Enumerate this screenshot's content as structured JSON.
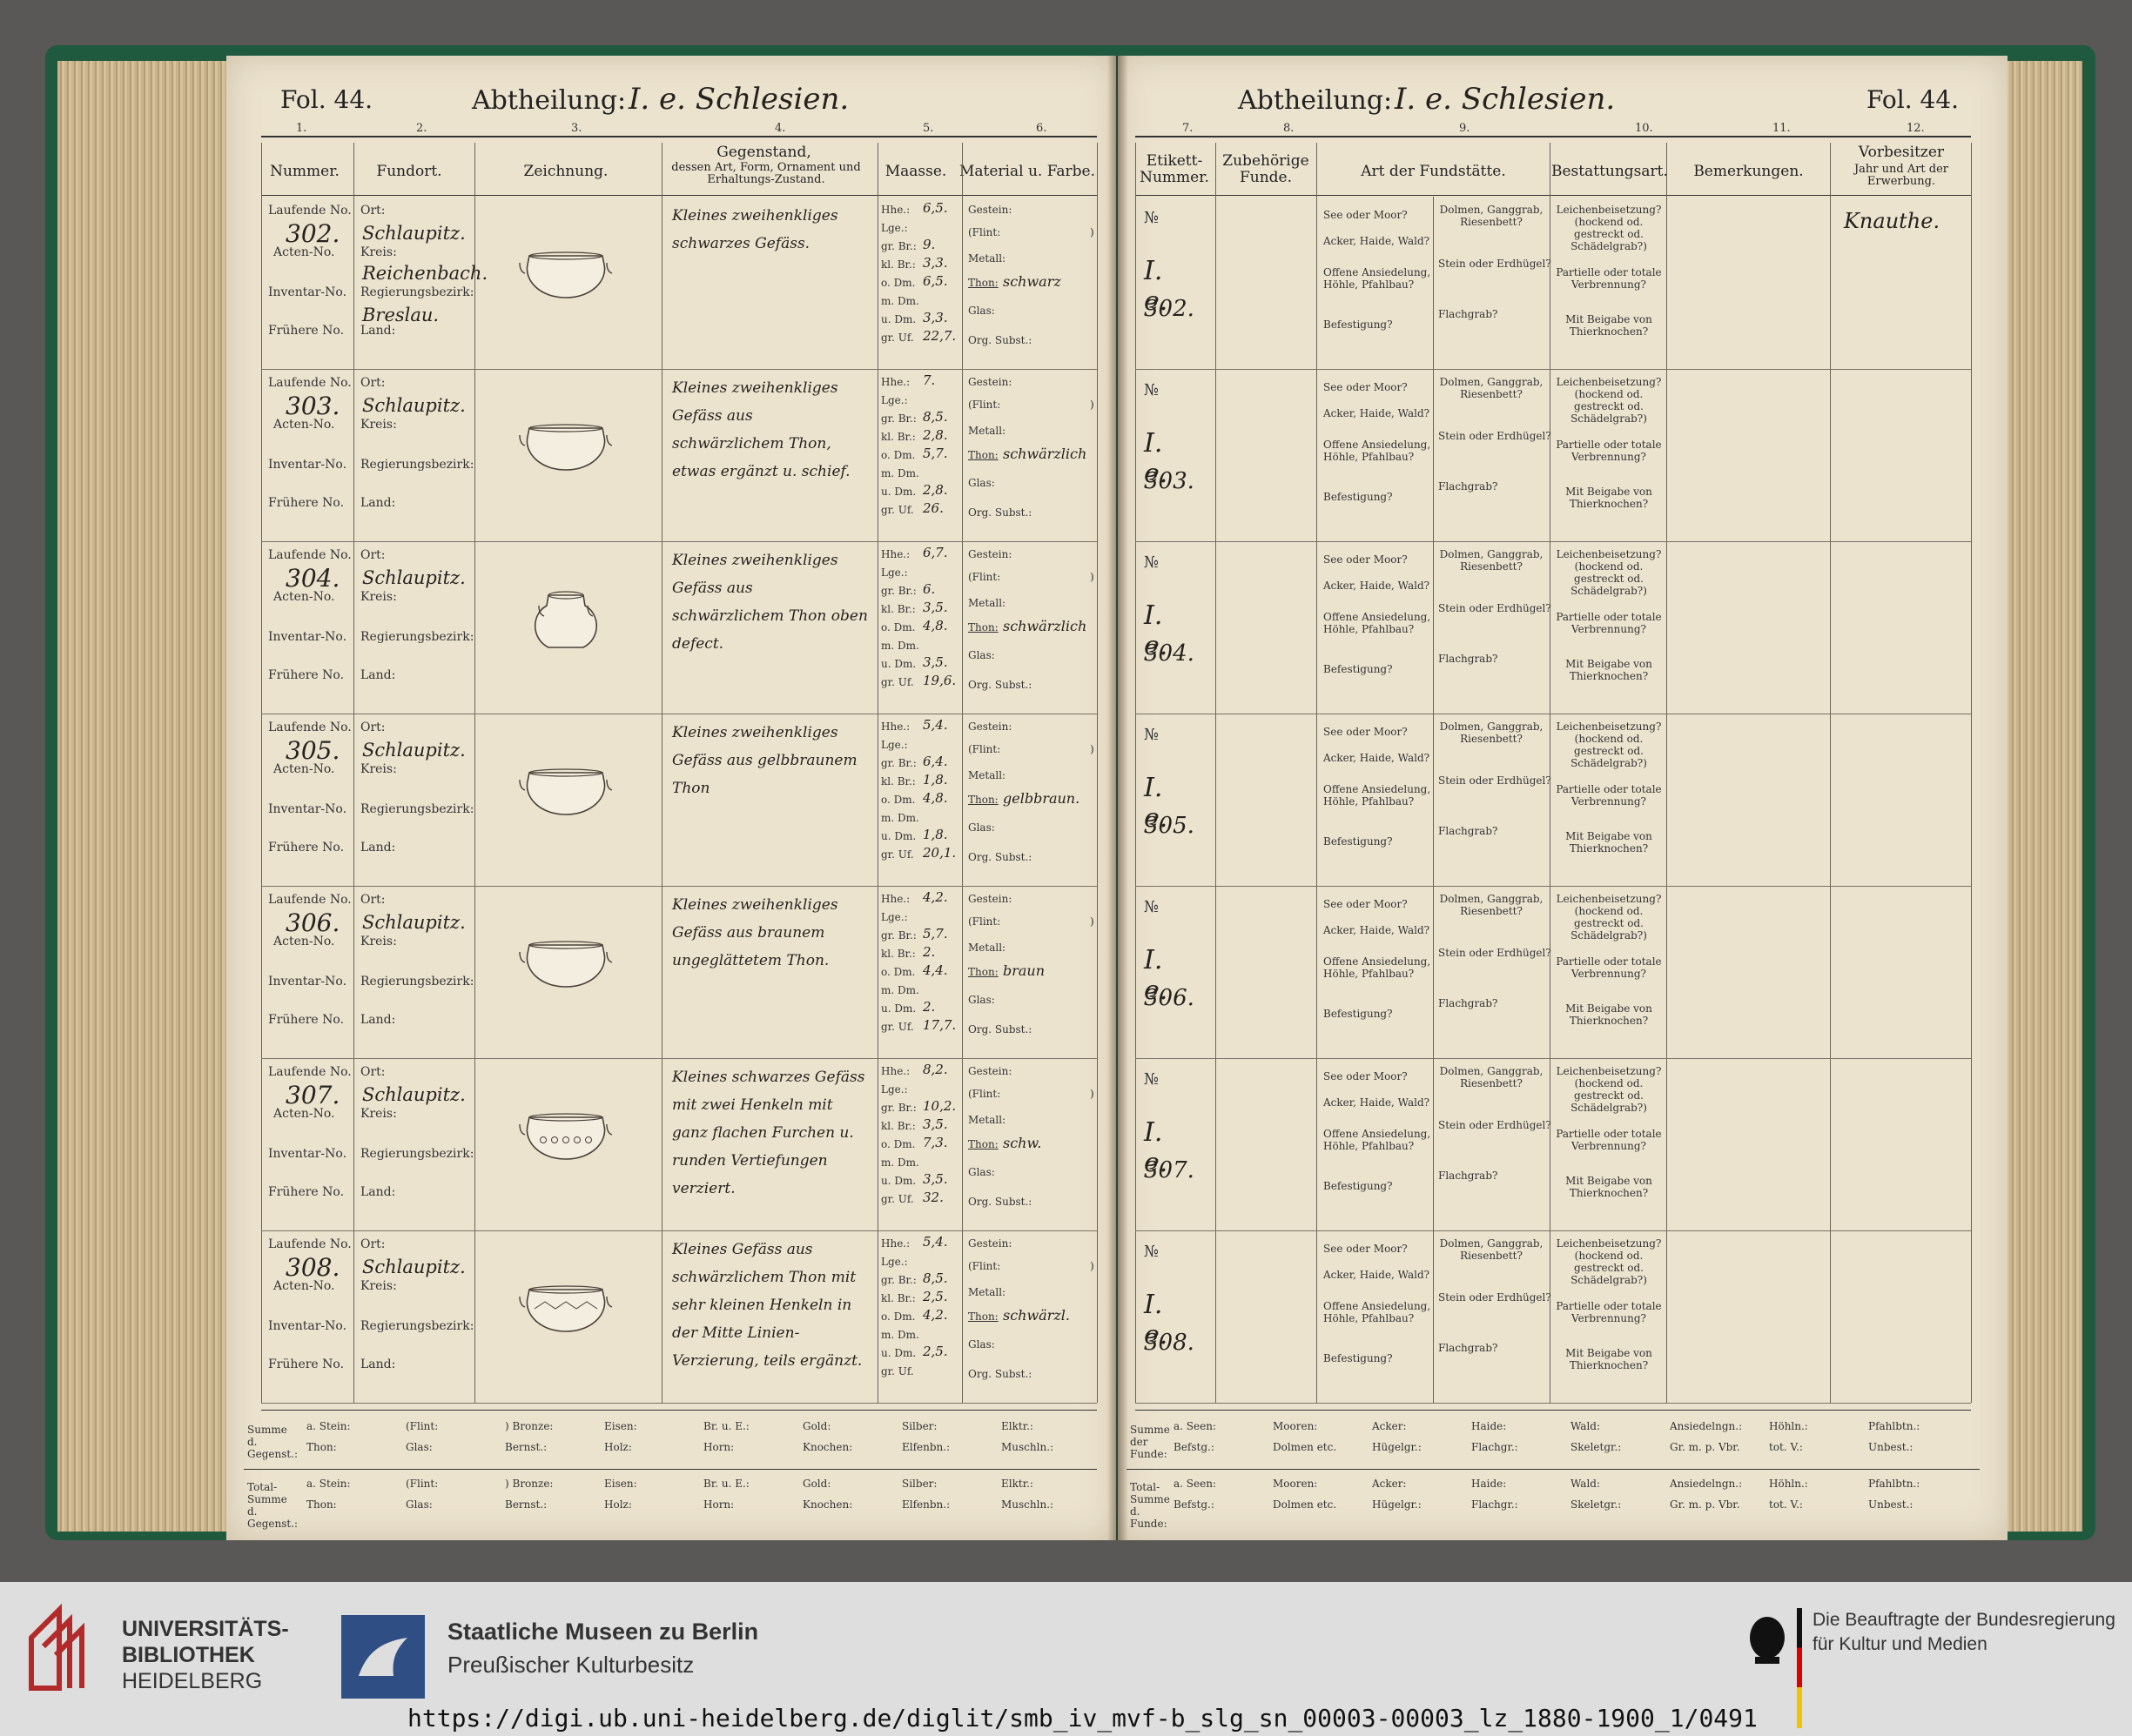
{
  "left_page": {
    "fol": "Fol. 44.",
    "abtheilung_label": "Abtheilung:",
    "abtheilung_value": "I. e. Schlesien.",
    "col_numbers": [
      "1.",
      "2.",
      "3.",
      "4.",
      "5.",
      "6."
    ],
    "headers": {
      "nummer": "Nummer.",
      "fundort": "Fundort.",
      "zeichnung": "Zeichnung.",
      "gegenstand": "Gegenstand,",
      "gegenstand_sub": "dessen Art, Form, Ornament und Erhaltungs-Zustand.",
      "maasse": "Maasse.",
      "material": "Material u. Farbe."
    }
  },
  "right_page": {
    "fol": "Fol. 44.",
    "abtheilung_label": "Abtheilung:",
    "abtheilung_value": "I. e. Schlesien.",
    "col_numbers": [
      "7.",
      "8.",
      "9.",
      "10.",
      "11.",
      "12."
    ],
    "headers": {
      "etikett": "Etikett-Nummer.",
      "zubehoerige": "Zubehörige Funde.",
      "fundstaette": "Art der Fundstätte.",
      "bestattung": "Bestattungsart.",
      "bemerkungen": "Bemerkungen.",
      "vorbesitzer": "Vorbesitzer",
      "vorbesitzer_sub": "Jahr und Art der Erwerbung."
    }
  },
  "row_labels": {
    "laufende": "Laufende No.",
    "acten": "Acten-No.",
    "inventar": "Inventar-No.",
    "fruehere": "Frühere No.",
    "ort": "Ort:",
    "kreis": "Kreis:",
    "regbez": "Regierungsbezirk:",
    "land": "Land:",
    "maasse": [
      "Hhe.:",
      "Lge.:",
      "gr. Br.:",
      "kl. Br.:",
      "o. Dm.",
      "m. Dm.",
      "u. Dm.",
      "gr. Uf."
    ],
    "material": [
      "Gestein:",
      "(Flint:",
      ")",
      "Metall:",
      "Thon:",
      "Glas:",
      "Org. Subst.:"
    ],
    "etikett_prefix": "№",
    "fundstaette": [
      "See oder Moor?",
      "Acker, Haide, Wald?",
      "Offene Ansiedelung, Höhle, Pfahlbau?",
      "Befestigung?"
    ],
    "grab": [
      "Dolmen, Ganggrab, Riesenbett?",
      "Stein oder Erdhügel?",
      "Flachgrab?"
    ],
    "bestattung": [
      "Leichenbeisetzung? (hockend od. gestreckt od. Schädelgrab?)",
      "Partielle oder totale Verbrennung?",
      "Mit Beigabe von Thierknochen?"
    ]
  },
  "entries": [
    {
      "lfd": "302.",
      "ort": "Schlaupitz.",
      "kreis": "Reichenbach.",
      "regbez": "Breslau.",
      "desc": "Kleines zweihenkliges schwarzes Gefäss.",
      "maasse": [
        "6,5.",
        "",
        "9.",
        "3,3.",
        "6,5.",
        "",
        "3,3.",
        "22,7."
      ],
      "thon": "schwarz",
      "etikett": "I. e.",
      "etikett_no": "302.",
      "vorbesitzer": "Knauthe."
    },
    {
      "lfd": "303.",
      "ort": "Schlaupitz.",
      "kreis": "",
      "regbez": "",
      "desc": "Kleines zweihenkliges Gefäss aus schwärzlichem Thon, etwas ergänzt u. schief.",
      "maasse": [
        "7.",
        "",
        "8,5.",
        "2,8.",
        "5,7.",
        "",
        "2,8.",
        "26."
      ],
      "thon": "schwärzlich",
      "etikett": "I. e.",
      "etikett_no": "303.",
      "vorbesitzer": ""
    },
    {
      "lfd": "304.",
      "ort": "Schlaupitz.",
      "kreis": "",
      "regbez": "",
      "desc": "Kleines zweihenkliges Gefäss aus schwärzlichem Thon oben defect.",
      "maasse": [
        "6,7.",
        "",
        "6.",
        "3,5.",
        "4,8.",
        "",
        "3,5.",
        "19,6."
      ],
      "thon": "schwärzlich",
      "etikett": "I. e.",
      "etikett_no": "304.",
      "vorbesitzer": ""
    },
    {
      "lfd": "305.",
      "ort": "Schlaupitz.",
      "kreis": "",
      "regbez": "",
      "desc": "Kleines zweihenkliges Gefäss aus gelbbraunem Thon",
      "maasse": [
        "5,4.",
        "",
        "6,4.",
        "1,8.",
        "4,8.",
        "",
        "1,8.",
        "20,1."
      ],
      "thon": "gelbbraun.",
      "etikett": "I. e.",
      "etikett_no": "305.",
      "vorbesitzer": ""
    },
    {
      "lfd": "306.",
      "ort": "Schlaupitz.",
      "kreis": "",
      "regbez": "",
      "desc": "Kleines zweihenkliges Gefäss aus braunem ungeglättetem Thon.",
      "maasse": [
        "4,2.",
        "",
        "5,7.",
        "2.",
        "4,4.",
        "",
        "2.",
        "17,7."
      ],
      "thon": "braun",
      "etikett": "I. e.",
      "etikett_no": "306.",
      "vorbesitzer": ""
    },
    {
      "lfd": "307.",
      "ort": "Schlaupitz.",
      "kreis": "",
      "regbez": "",
      "desc": "Kleines schwarzes Gefäss mit zwei Henkeln mit ganz flachen Furchen u. runden Vertiefungen verziert.",
      "maasse": [
        "8,2.",
        "",
        "10,2.",
        "3,5.",
        "7,3.",
        "",
        "3,5.",
        "32."
      ],
      "thon": "schw.",
      "etikett": "I. e.",
      "etikett_no": "307.",
      "vorbesitzer": ""
    },
    {
      "lfd": "308.",
      "ort": "Schlaupitz.",
      "kreis": "",
      "regbez": "",
      "desc": "Kleines Gefäss aus schwärzlichem Thon mit sehr kleinen Henkeln in der Mitte Linien-Verzierung, teils ergänzt.",
      "maasse": [
        "5,4.",
        "",
        "8,5.",
        "2,5.",
        "4,2.",
        "",
        "2,5.",
        ""
      ],
      "thon": "schwärzl.",
      "etikett": "I. e.",
      "etikett_no": "308.",
      "vorbesitzer": ""
    }
  ],
  "summary": {
    "left_row1_label": "Summe d. Gegenst.:",
    "left_row2_label": "Total-Summe d. Gegenst.:",
    "left_top": [
      "a. Stein:",
      "(Flint:",
      ") Bronze:",
      "Eisen:",
      "Br. u. E.:",
      "Gold:",
      "Silber:",
      "Elktr.:"
    ],
    "left_bottom": [
      "Thon:",
      "Glas:",
      "Bernst.:",
      "Holz:",
      "Horn:",
      "Knochen:",
      "Elfenbn.:",
      "Muschln.:"
    ],
    "right_row1_label": "Summe der Funde:",
    "right_row2_label": "Total-Summe d. Funde:",
    "right_top": [
      "a. Seen:",
      "Mooren:",
      "Acker:",
      "Haide:",
      "Wald:",
      "Ansiedelngn.:",
      "Höhln.:",
      "Pfahlbtn.:"
    ],
    "right_bottom": [
      "Befstg.:",
      "Dolmen etc.",
      "Hügelgr.:",
      "Flachgr.:",
      "Skeletgr.:",
      "Gr. m. p. Vbr.",
      "tot. V.:",
      "Unbest.:"
    ]
  },
  "footer": {
    "ub_line1": "UNIVERSITÄTS-",
    "ub_line2": "BIBLIOTHEK",
    "ub_line3": "HEIDELBERG",
    "smb_line1": "Staatliche Museen zu Berlin",
    "smb_line2": "Preußischer Kulturbesitz",
    "bkm_line1": "Die Beauftragte der Bundesregierung",
    "bkm_line2": "für Kultur und Medien",
    "url": "https://digi.ub.uni-heidelberg.de/diglit/smb_iv_mvf-b_slg_sn_00003-00003_lz_1880-1900_1/0491"
  },
  "colors": {
    "paper": "#ece3cf",
    "binding": "#1f5a3f",
    "footer_bg": "#dedede",
    "ub_red": "#b22a2a",
    "smb_blue": "#2f4f84"
  }
}
